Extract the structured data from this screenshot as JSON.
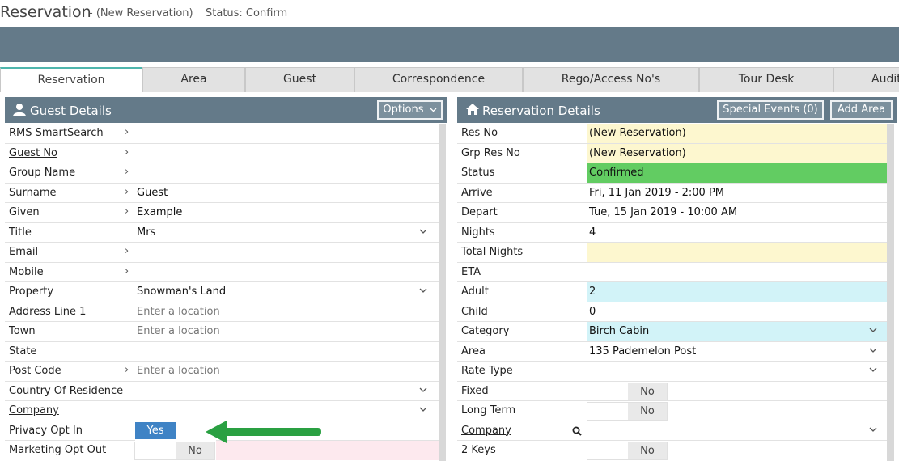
{
  "title": {
    "main": "Reservation",
    "sub": "-   (New Reservation)",
    "status": "Status: Confirm"
  },
  "tabs": [
    "Reservation",
    "Area",
    "Guest",
    "Correspondence",
    "Rego/Access No's",
    "Tour Desk",
    "Audit"
  ],
  "guest_panel": {
    "title": "Guest Details",
    "options_label": "Options",
    "icon": "user-icon",
    "rows": [
      {
        "label": "RMS SmartSearch",
        "value": ""
      },
      {
        "label": "Guest No",
        "value": ""
      },
      {
        "label": "Group Name",
        "value": ""
      },
      {
        "label": "Surname",
        "value": "Guest"
      },
      {
        "label": "Given",
        "value": "Example"
      },
      {
        "label": "Title",
        "value": "Mrs"
      },
      {
        "label": "Email",
        "value": ""
      },
      {
        "label": "Mobile",
        "value": ""
      },
      {
        "label": "Property",
        "value": "Snowman's Land"
      },
      {
        "label": "Address Line 1",
        "placeholder": "Enter a location"
      },
      {
        "label": "Town",
        "placeholder": "Enter a location"
      },
      {
        "label": "State",
        "value": ""
      },
      {
        "label": "Post Code",
        "placeholder": "Enter a location"
      },
      {
        "label": "Country Of Residence",
        "value": ""
      },
      {
        "label": "Company",
        "value": ""
      },
      {
        "label": "Privacy Opt In",
        "toggle_yes": "Yes"
      },
      {
        "label": "Marketing Opt Out",
        "toggle_no": "No"
      }
    ]
  },
  "res_panel": {
    "title": "Reservation Details",
    "icon": "home-icon",
    "special_events_label": "Special Events (0)",
    "add_area_label": "Add Area",
    "rows": [
      {
        "label": "Res No",
        "value": "(New Reservation)"
      },
      {
        "label": "Grp Res No",
        "value": "(New Reservation)"
      },
      {
        "label": "Status",
        "value": "Confirmed"
      },
      {
        "label": "Arrive",
        "value": "Fri, 11 Jan 2019 - 2:00 PM"
      },
      {
        "label": "Depart",
        "value": "Tue, 15 Jan 2019 - 10:00 AM"
      },
      {
        "label": "Nights",
        "value": "4"
      },
      {
        "label": "Total Nights",
        "value": ""
      },
      {
        "label": "ETA",
        "value": ""
      },
      {
        "label": "Adult",
        "value": "2"
      },
      {
        "label": "Child",
        "value": "0"
      },
      {
        "label": "Category",
        "value": "Birch Cabin"
      },
      {
        "label": "Area",
        "value": "135 Pademelon Post"
      },
      {
        "label": "Rate Type",
        "value": ""
      },
      {
        "label": "Fixed",
        "toggle_no": "No"
      },
      {
        "label": "Long Term",
        "toggle_no": "No"
      },
      {
        "label": "Company",
        "value": ""
      },
      {
        "label": "2 Keys",
        "toggle_no": "No"
      }
    ]
  },
  "colors": {
    "banner": "#647a89",
    "tab_accent": "#4fb6ad",
    "yellow_field": "#fdf7cf",
    "green_status": "#62cc62",
    "cyan_field": "#d2f3f8",
    "pink_field": "#fde9ee",
    "toggle_yes": "#3f83c5",
    "arrow": "#2aa042"
  }
}
